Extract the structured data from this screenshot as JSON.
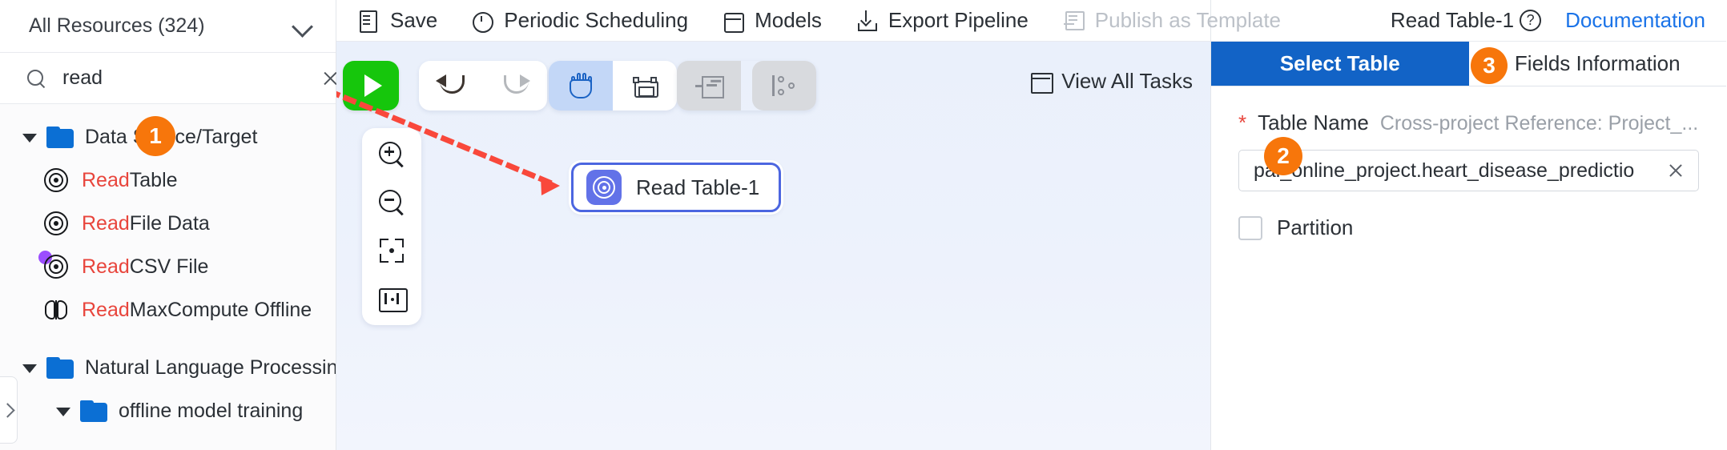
{
  "sidebar": {
    "resource_select": {
      "label": "All Resources (324)",
      "icon": "chevron-down-icon"
    },
    "search": {
      "value": "read",
      "placeholder": "Search",
      "icon": "search-icon",
      "clear_icon": "close-icon"
    },
    "tree": [
      {
        "type": "group",
        "label": "Data Source/Target",
        "icon": "folder-icon",
        "expanded": true
      },
      {
        "type": "leaf",
        "match": "Read",
        "label": " Table",
        "icon": "target-icon",
        "badge": false
      },
      {
        "type": "leaf",
        "match": "Read",
        "label": " File Data",
        "icon": "target-icon",
        "badge": false
      },
      {
        "type": "leaf",
        "match": "Read",
        "label": " CSV File",
        "icon": "target-icon",
        "badge": true
      },
      {
        "type": "leaf",
        "match": "Read",
        "label": " MaxCompute Offline",
        "icon": "brain-icon",
        "badge": false
      },
      {
        "type": "group",
        "label": "Natural Language Processing",
        "icon": "folder-icon",
        "expanded": true
      },
      {
        "type": "sub",
        "label": "offline model training",
        "icon": "folder-icon",
        "expanded": true
      }
    ],
    "collapse_handle": "chevron-right-icon"
  },
  "toolbar": {
    "items": [
      {
        "label": "Save",
        "icon": "save-icon",
        "disabled": false
      },
      {
        "label": "Periodic Scheduling",
        "icon": "clock-icon",
        "disabled": false
      },
      {
        "label": "Models",
        "icon": "cube-icon",
        "disabled": false
      },
      {
        "label": "Export Pipeline",
        "icon": "export-icon",
        "disabled": false
      },
      {
        "label": "Publish as Template",
        "icon": "publish-icon",
        "disabled": true
      }
    ]
  },
  "canvas": {
    "run_button": {
      "name": "run-button",
      "icon": "play-icon",
      "color": "#16c60c"
    },
    "tools": [
      {
        "name": "undo-button",
        "icon": "undo-icon",
        "state": "enabled"
      },
      {
        "name": "redo-button",
        "icon": "redo-icon",
        "state": "disabled"
      },
      {
        "name": "pan-tool-button",
        "icon": "hand-icon",
        "state": "active"
      },
      {
        "name": "select-frame-button",
        "icon": "frame-icon",
        "state": "enabled"
      },
      {
        "name": "add-node-button",
        "icon": "add-node-icon",
        "state": "disabled"
      },
      {
        "name": "graph-view-button",
        "icon": "graph-icon",
        "state": "disabled"
      }
    ],
    "view_all_tasks": {
      "label": "View All Tasks",
      "icon": "calendar-icon"
    },
    "zoom_tools": [
      {
        "name": "zoom-in-button",
        "icon": "zoom-in-icon"
      },
      {
        "name": "zoom-out-button",
        "icon": "zoom-out-icon"
      },
      {
        "name": "fit-to-screen-button",
        "icon": "fit-screen-icon"
      },
      {
        "name": "actual-size-button",
        "icon": "one-to-one-icon"
      }
    ],
    "node": {
      "label": "Read Table-1",
      "icon": "read-table-icon",
      "selected": true
    }
  },
  "right_panel": {
    "title": "Read Table-1",
    "help_icon": "question-icon",
    "documentation_link": "Documentation",
    "tabs": [
      {
        "label": "Select Table",
        "active": true
      },
      {
        "label": "Fields Information",
        "active": false
      }
    ],
    "table_name_field": {
      "required_marker": "*",
      "label": "Table Name",
      "hint": "Cross-project Reference: Project_...",
      "value": "pai_online_project.heart_disease_predictio",
      "clear_icon": "close-icon"
    },
    "partition_checkbox": {
      "label": "Partition",
      "checked": false
    }
  },
  "annotations": {
    "badge1": "1",
    "badge2": "2",
    "badge3": "3",
    "arrow_color": "#f9483b",
    "badge_color": "#f7760b"
  }
}
